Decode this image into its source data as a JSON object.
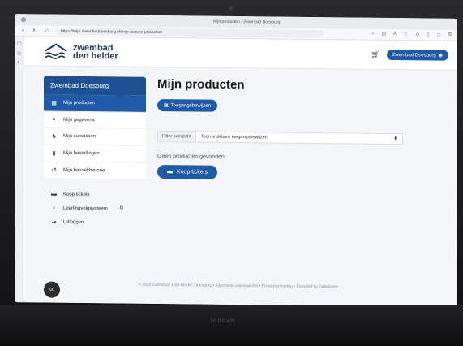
{
  "browser": {
    "window_title": "Mijn producten - Zwembad Doesburg",
    "url": "https://mijn.zwembaddoesburg.nl/mijn-actieve-producten",
    "icons": [
      "back-icon",
      "refresh-icon",
      "home-icon",
      "star-icon",
      "extensions-icon"
    ]
  },
  "header": {
    "logo_line1": "zwembad",
    "logo_line2": "den helder",
    "cart_icon": "cart-icon",
    "account_label": "Zwembad Doesburg"
  },
  "sidebar": {
    "title": "Zwembad Doesburg",
    "items": [
      {
        "label": "Mijn producten",
        "icon": "grid-icon",
        "active": true
      },
      {
        "label": "Mijn gegevens",
        "icon": "user-icon",
        "active": false
      },
      {
        "label": "Mijn cursussen",
        "icon": "course-icon",
        "active": false
      },
      {
        "label": "Mijn bestellingen",
        "icon": "file-icon",
        "active": false
      },
      {
        "label": "Mijn bezoekhistorie",
        "icon": "history-icon",
        "active": false
      }
    ],
    "links": [
      {
        "label": "Koop tickets",
        "icon": "ticket-icon"
      },
      {
        "label": "Leerlingvolgsysteem",
        "icon": "pin-icon"
      },
      {
        "label": "Uitloggen",
        "icon": "logout-icon"
      }
    ]
  },
  "main": {
    "title": "Mijn producten",
    "tab_button": "Toegangsbewijzen",
    "filter_label": "Filter overzicht",
    "filter_value": "Toon bruikbare toegangsbewijzen",
    "empty_message": "Geen producten gevonden.",
    "buy_button": "Koop tickets"
  },
  "footer": {
    "text": "© 2024 Zwembad 'Den Helder' Doesburg • Algemene voorwaarden • Privacyverklaring • Powered by Datadoeke"
  },
  "colors": {
    "primary": "#1e5aa8",
    "sidebar_title": "#1e4f91",
    "logo_text": "#1f3a5f"
  }
}
